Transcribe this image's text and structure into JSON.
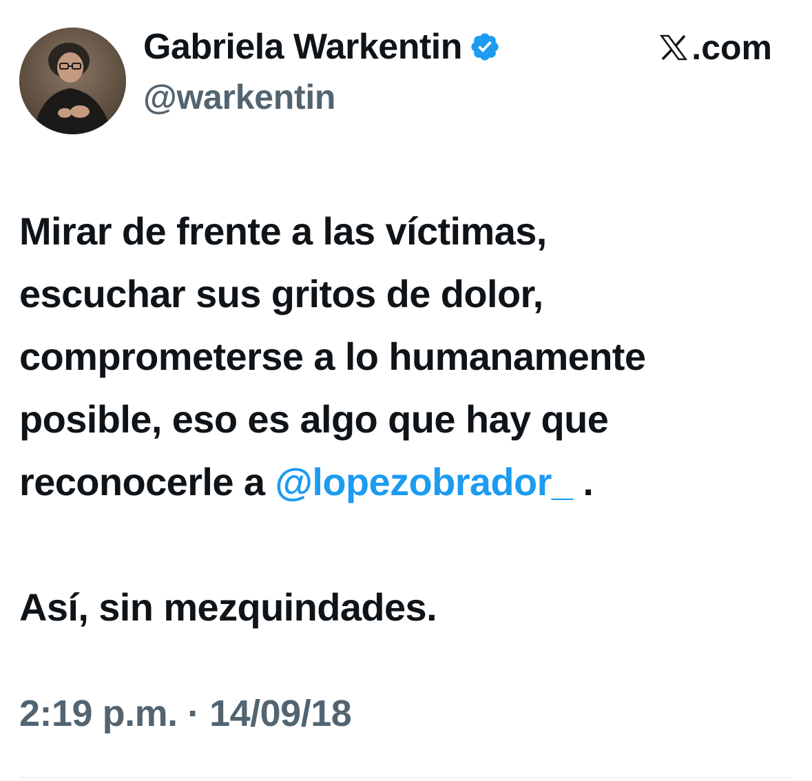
{
  "author": {
    "display_name": "Gabriela Warkentin",
    "handle": "@warkentin",
    "verified": true,
    "verified_icon": "verified-badge-icon",
    "avatar_icon": "profile-photo"
  },
  "source": {
    "logo_icon": "x-logo-icon",
    "label": ".com"
  },
  "tweet": {
    "lines": [
      "Mirar de frente a las víctimas,",
      "escuchar sus gritos de dolor,",
      "comprometerse a lo humanamente",
      "posible, eso es algo que hay que"
    ],
    "last_line_prefix": "reconocerle a ",
    "mention": "@lopezobrador_",
    "last_line_suffix": " .",
    "closing": "Así, sin mezquindades."
  },
  "meta": {
    "timestamp": "2:19 p.m. · 14/09/18"
  },
  "colors": {
    "text": "#0f1419",
    "secondary": "#536471",
    "link": "#1d9bf0",
    "verified": "#1d9bf0"
  }
}
